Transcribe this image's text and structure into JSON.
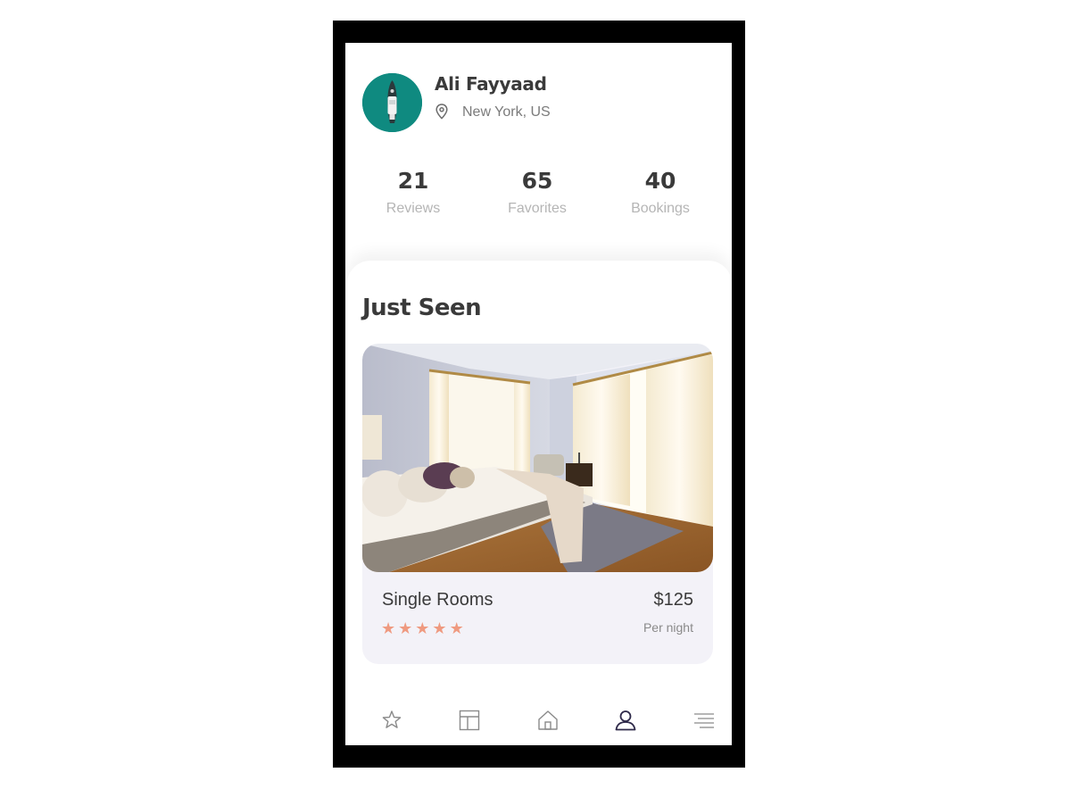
{
  "profile": {
    "name": "Ali Fayyaad",
    "location": "New York, US",
    "avatar_icon": "boat-avatar"
  },
  "stats": [
    {
      "value": "21",
      "label": "Reviews"
    },
    {
      "value": "65",
      "label": "Favorites"
    },
    {
      "value": "40",
      "label": "Bookings"
    }
  ],
  "just_seen": {
    "title": "Just Seen",
    "card": {
      "name": "Single Rooms",
      "price": "$125",
      "per": "Per night",
      "rating": 5,
      "image": "bedroom-photo"
    }
  },
  "bottom_nav": [
    {
      "icon": "star-icon"
    },
    {
      "icon": "layout-icon"
    },
    {
      "icon": "home-icon"
    },
    {
      "icon": "user-icon",
      "active": true
    },
    {
      "icon": "menu-icon"
    }
  ],
  "colors": {
    "avatar_bg": "#0f8a80",
    "star": "#ef9a80",
    "card_bg": "#f3f2f8",
    "nav_active": "#2f2a4a",
    "nav_inactive": "#9a9a9a"
  }
}
